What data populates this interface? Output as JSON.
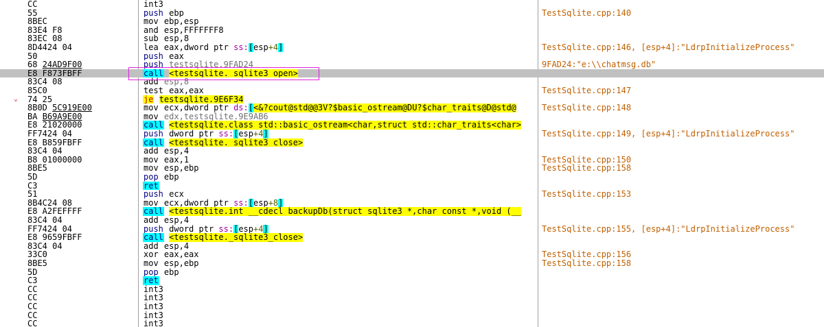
{
  "disassembly": {
    "rows": [
      {
        "bytes": "CC",
        "mnemonic": "int3",
        "operands": "",
        "comment": ""
      },
      {
        "bytes": "55",
        "mnemonic": "push",
        "operands": "ebp",
        "comment": "TestSqlite.cpp:140"
      },
      {
        "bytes": "8BEC",
        "mnemonic": "mov",
        "operands": "ebp,esp",
        "comment": ""
      },
      {
        "bytes": "83E4 F8",
        "mnemonic": "and",
        "operands": "esp,FFFFFFF8",
        "comment": ""
      },
      {
        "bytes": "83EC 08",
        "mnemonic": "sub",
        "operands": "esp,8",
        "comment": ""
      },
      {
        "bytes": "8D4424 04",
        "mnemonic": "lea",
        "operands": "eax,dword ptr ss:[esp+4]",
        "comment": "TestSqlite.cpp:146, [esp+4]:\"LdrpInitializeProcess\""
      },
      {
        "bytes": "50",
        "mnemonic": "push",
        "operands": "eax",
        "comment": ""
      },
      {
        "bytes": "68 24AD9F00",
        "mnemonic": "push",
        "operands": "testsqlite.9FAD24",
        "comment": "9FAD24:\"e:\\\\chatmsg.db\""
      },
      {
        "bytes": "E8 F873FBFF",
        "mnemonic": "call",
        "operands": "<testsqlite._sqlite3_open>",
        "comment": ""
      },
      {
        "bytes": "83C4 08",
        "mnemonic": "add",
        "operands": "esp,8",
        "comment": ""
      },
      {
        "bytes": "85C0",
        "mnemonic": "test",
        "operands": "eax,eax",
        "comment": "TestSqlite.cpp:147"
      },
      {
        "bytes": "74 25",
        "mnemonic": "je",
        "operands": "testsqlite.9E6F34",
        "comment": ""
      },
      {
        "bytes": "8B0D 5C919E00",
        "mnemonic": "mov",
        "operands": "ecx,dword ptr ds:[<&?cout@std@@3V?$basic_ostream@DU?$char_traits@D@std@",
        "comment": "TestSqlite.cpp:148"
      },
      {
        "bytes": "BA B69A9E00",
        "mnemonic": "mov",
        "operands": "edx,testsqlite.9E9AB6",
        "comment": ""
      },
      {
        "bytes": "E8 21020000",
        "mnemonic": "call",
        "operands": "<testsqlite.class std::basic_ostream<char,struct std::char_traits<char>",
        "comment": ""
      },
      {
        "bytes": "FF7424 04",
        "mnemonic": "push",
        "operands": "dword ptr ss:[esp+4]",
        "comment": "TestSqlite.cpp:149, [esp+4]:\"LdrpInitializeProcess\""
      },
      {
        "bytes": "E8 B859FBFF",
        "mnemonic": "call",
        "operands": "<testsqlite._sqlite3_close>",
        "comment": ""
      },
      {
        "bytes": "83C4 04",
        "mnemonic": "add",
        "operands": "esp,4",
        "comment": ""
      },
      {
        "bytes": "B8 01000000",
        "mnemonic": "mov",
        "operands": "eax,1",
        "comment": "TestSqlite.cpp:150"
      },
      {
        "bytes": "8BE5",
        "mnemonic": "mov",
        "operands": "esp,ebp",
        "comment": "TestSqlite.cpp:158"
      },
      {
        "bytes": "5D",
        "mnemonic": "pop",
        "operands": "ebp",
        "comment": ""
      },
      {
        "bytes": "C3",
        "mnemonic": "ret",
        "operands": "",
        "comment": ""
      },
      {
        "bytes": "51",
        "mnemonic": "push",
        "operands": "ecx",
        "comment": "TestSqlite.cpp:153"
      },
      {
        "bytes": "8B4C24 08",
        "mnemonic": "mov",
        "operands": "ecx,dword ptr ss:[esp+8]",
        "comment": ""
      },
      {
        "bytes": "E8 A2FEFFFF",
        "mnemonic": "call",
        "operands": "<testsqlite.int __cdecl backupDb(struct sqlite3 *,char const *,void (__",
        "comment": ""
      },
      {
        "bytes": "83C4 04",
        "mnemonic": "add",
        "operands": "esp,4",
        "comment": ""
      },
      {
        "bytes": "FF7424 04",
        "mnemonic": "push",
        "operands": "dword ptr ss:[esp+4]",
        "comment": "TestSqlite.cpp:155, [esp+4]:\"LdrpInitializeProcess\""
      },
      {
        "bytes": "E8 9659FBFF",
        "mnemonic": "call",
        "operands": "<testsqlite._sqlite3_close>",
        "comment": ""
      },
      {
        "bytes": "83C4 04",
        "mnemonic": "add",
        "operands": "esp,4",
        "comment": ""
      },
      {
        "bytes": "33C0",
        "mnemonic": "xor",
        "operands": "eax,eax",
        "comment": "TestSqlite.cpp:156"
      },
      {
        "bytes": "8BE5",
        "mnemonic": "mov",
        "operands": "esp,ebp",
        "comment": "TestSqlite.cpp:158"
      },
      {
        "bytes": "5D",
        "mnemonic": "pop",
        "operands": "ebp",
        "comment": ""
      },
      {
        "bytes": "C3",
        "mnemonic": "ret",
        "operands": "",
        "comment": ""
      },
      {
        "bytes": "CC",
        "mnemonic": "int3",
        "operands": "",
        "comment": ""
      },
      {
        "bytes": "CC",
        "mnemonic": "int3",
        "operands": "",
        "comment": ""
      },
      {
        "bytes": "CC",
        "mnemonic": "int3",
        "operands": "",
        "comment": ""
      },
      {
        "bytes": "CC",
        "mnemonic": "int3",
        "operands": "",
        "comment": ""
      },
      {
        "bytes": "CC",
        "mnemonic": "int3",
        "operands": "",
        "comment": ""
      }
    ],
    "selected_row": 8,
    "jump_arrow_row": 11,
    "jump_arrow_glyph": "⌄",
    "dimmed_rows": [
      7,
      9,
      13
    ],
    "colors": {
      "selection": "#c0c0c0",
      "call_highlight": "#00ffff",
      "jump_highlight": "#ffff00",
      "comment_text": "#c06000",
      "annotation_box": "#e020e0",
      "jump_arrow": "#c82828"
    }
  }
}
